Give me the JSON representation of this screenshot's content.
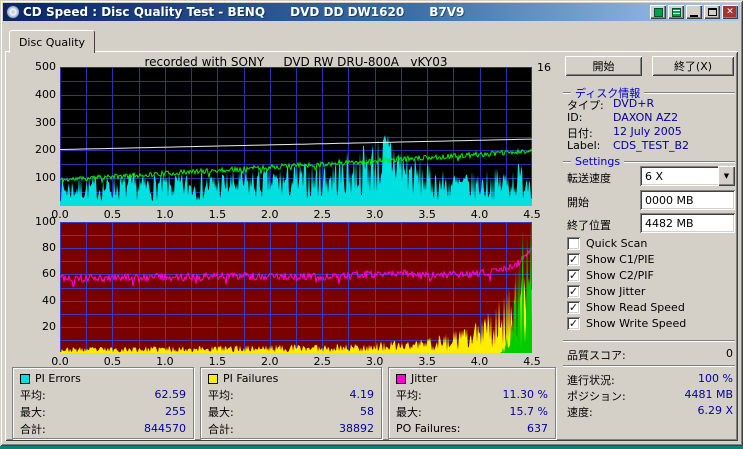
{
  "window": {
    "title": "CD Speed : Disc Quality Test - BENQ      DVD DD DW1620      B7V9"
  },
  "tab": {
    "label": "Disc Quality"
  },
  "chart_header": "recorded with SONY     DVD RW DRU-800A   vKY03",
  "chart_data": [
    {
      "type": "area",
      "title": "recorded with SONY DVD RW DRU-800A vKY03",
      "x_range": [
        0,
        4.5
      ],
      "x_grid_step": 0.25,
      "x_ticks": [
        "0.0",
        "0.5",
        "1.0",
        "1.5",
        "2.0",
        "2.5",
        "3.0",
        "3.5",
        "4.0",
        "4.5"
      ],
      "y_left": {
        "range": [
          0,
          500
        ],
        "grid_step": 50,
        "ticks": [
          "500",
          "400",
          "300",
          "200",
          "100"
        ]
      },
      "y_right": {
        "range": [
          0,
          16
        ],
        "ticks": [
          "16"
        ]
      },
      "bg": "#000000",
      "grid": "#2c2cb4",
      "series": [
        {
          "name": "PI Errors",
          "type": "area-spiky",
          "axis": "left",
          "color": "#00e0e0",
          "seed": 7,
          "floor": 0.18,
          "span": 1.05,
          "max": 255,
          "average": 62.59,
          "maximum": 255,
          "total": 844570,
          "points": [
            [
              0,
              85
            ],
            [
              0.5,
              95
            ],
            [
              1,
              100
            ],
            [
              1.5,
              106
            ],
            [
              2,
              118
            ],
            [
              2.4,
              132
            ],
            [
              2.7,
              158
            ],
            [
              2.9,
              188
            ],
            [
              3.05,
              225
            ],
            [
              3.15,
              250
            ],
            [
              3.25,
              205
            ],
            [
              3.4,
              148
            ],
            [
              3.6,
              112
            ],
            [
              3.9,
              102
            ],
            [
              4.2,
              115
            ],
            [
              4.5,
              145
            ]
          ]
        },
        {
          "name": "Write Speed",
          "type": "line-noise",
          "axis": "right",
          "color": "#00ee00",
          "seed": 11,
          "noise": 0.3,
          "points": [
            [
              0,
              3.0
            ],
            [
              4.5,
              6.3
            ]
          ]
        },
        {
          "name": "Read Speed",
          "type": "line",
          "axis": "right",
          "color": "#ececec",
          "seed": 3,
          "points": [
            [
              0,
              6.5
            ],
            [
              4.5,
              7.7
            ]
          ]
        }
      ]
    },
    {
      "type": "area",
      "x_range": [
        0,
        4.5
      ],
      "x_grid_step": 0.25,
      "x_ticks": [
        "0.0",
        "0.5",
        "1.0",
        "1.5",
        "2.0",
        "2.5",
        "3.0",
        "3.5",
        "4.0",
        "4.5"
      ],
      "y_left": {
        "range": [
          0,
          100
        ],
        "grid_step": 10,
        "ticks": [
          "100",
          "80",
          "60",
          "40",
          "20"
        ]
      },
      "bg": "#7a0000",
      "grid": "#3c3cc0",
      "series": [
        {
          "name": "PI Failures",
          "type": "area-spiky",
          "axis": "left",
          "color": "#ffee00",
          "seed": 23,
          "floor": 0.1,
          "span": 1.0,
          "max": 58,
          "average": 4.19,
          "maximum": 58,
          "total": 38892,
          "points": [
            [
              0,
              4
            ],
            [
              1,
              5
            ],
            [
              2,
              6
            ],
            [
              2.8,
              7
            ],
            [
              3.3,
              9
            ],
            [
              3.6,
              13
            ],
            [
              3.9,
              18
            ],
            [
              4.1,
              30
            ],
            [
              4.25,
              44
            ],
            [
              4.4,
              55
            ],
            [
              4.5,
              58
            ]
          ]
        },
        {
          "name": "Jitter",
          "type": "line-noise",
          "axis": "left",
          "color": "#ff00dd",
          "seed": 41,
          "noise": 3,
          "average_pct": "11.30 %",
          "maximum_pct": "15.7 %",
          "points": [
            [
              0,
              57
            ],
            [
              1,
              58
            ],
            [
              2,
              58.5
            ],
            [
              2.5,
              58
            ],
            [
              3,
              60
            ],
            [
              3.2,
              61
            ],
            [
              3.5,
              59
            ],
            [
              4,
              61
            ],
            [
              4.2,
              63
            ],
            [
              4.35,
              67
            ],
            [
              4.5,
              78
            ]
          ]
        },
        {
          "name": "C2 Errors",
          "type": "area-spiky",
          "axis": "left",
          "color": "#00cc00",
          "seed": 31,
          "floor": 0,
          "span": 1.15,
          "po_failures": 637,
          "points": [
            [
              0,
              0
            ],
            [
              4.2,
              0
            ],
            [
              4.28,
              15
            ],
            [
              4.35,
              60
            ],
            [
              4.42,
              90
            ],
            [
              4.5,
              100
            ]
          ]
        }
      ]
    }
  ],
  "legend": {
    "groups": [
      {
        "swatch": "#00e0e0",
        "title": "PI Errors",
        "rows": [
          {
            "label": "平均:",
            "value": "62.59"
          },
          {
            "label": "最大:",
            "value": "255"
          },
          {
            "label": "合計:",
            "value": "844570"
          }
        ]
      },
      {
        "swatch": "#ffee00",
        "title": "PI Failures",
        "rows": [
          {
            "label": "平均:",
            "value": "4.19"
          },
          {
            "label": "最大:",
            "value": "58"
          },
          {
            "label": "合計:",
            "value": "38892"
          }
        ]
      },
      {
        "swatch": "#ff00dd",
        "title": "Jitter",
        "rows": [
          {
            "label": "平均:",
            "value": "11.30 %"
          },
          {
            "label": "最大:",
            "value": "15.7 %"
          },
          {
            "label": "PO Failures:",
            "value": "637"
          }
        ]
      }
    ]
  },
  "panel": {
    "start_button": "開始",
    "exit_button": "終了(X)",
    "disc_info": {
      "section_label": "ディスク情報",
      "rows": [
        {
          "label": "タイプ:",
          "value": "DVD+R"
        },
        {
          "label": "ID:",
          "value": "DAXON AZ2"
        },
        {
          "label": "日付:",
          "value": "12 July 2005"
        },
        {
          "label": "Label:",
          "value": "CDS_TEST_B2"
        }
      ]
    },
    "settings": {
      "section_label": "Settings",
      "speed_label": "転送速度",
      "speed_value": "6 X",
      "start_label": "開始",
      "start_value": "0000 MB",
      "end_label": "終了位置",
      "end_value": "4482 MB",
      "checkboxes": [
        {
          "label": "Quick Scan",
          "checked": false
        },
        {
          "label": "Show C1/PIE",
          "checked": true
        },
        {
          "label": "Show C2/PIF",
          "checked": true
        },
        {
          "label": "Show Jitter",
          "checked": true
        },
        {
          "label": "Show Read Speed",
          "checked": true
        },
        {
          "label": "Show Write Speed",
          "checked": true
        }
      ]
    },
    "status": {
      "score_label": "品質スコア:",
      "score_value": "0",
      "progress_label": "進行状況:",
      "progress_value": "100 %",
      "position_label": "ポジション:",
      "position_value": "4481 MB",
      "speed_label": "速度:",
      "speed_value": "6.29 X"
    }
  }
}
